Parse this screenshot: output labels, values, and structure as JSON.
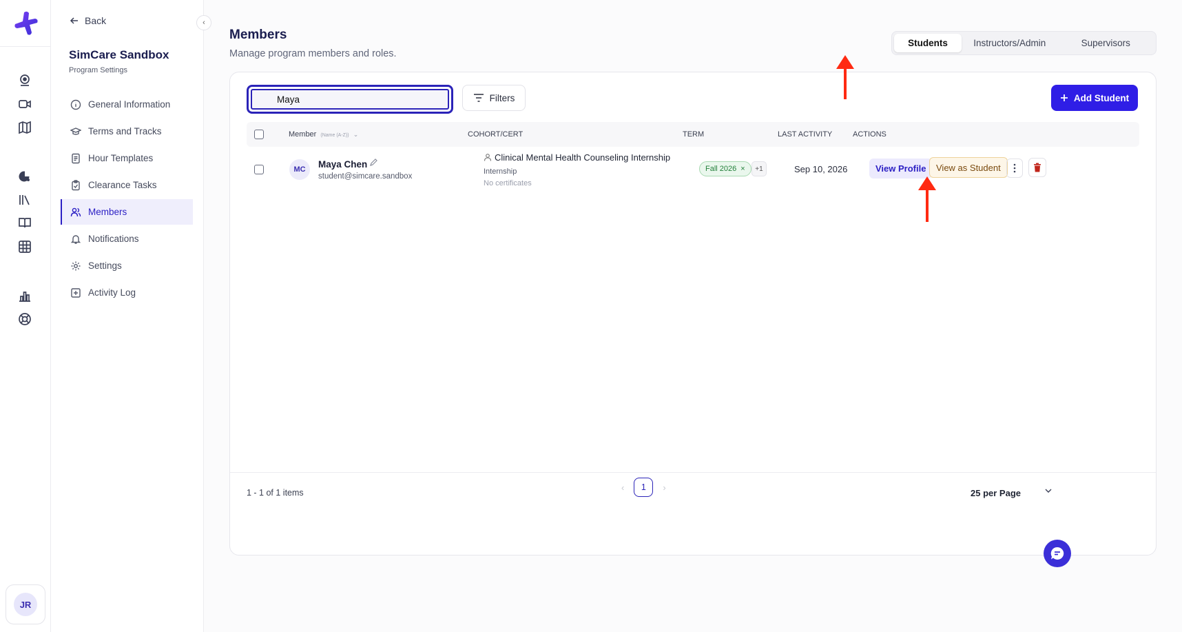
{
  "rail": {
    "avatar_initials": "JR",
    "icons": [
      "webcam-icon",
      "video-camera-icon",
      "map-icon",
      "chart-pie-icon",
      "library-icon",
      "open-book-icon",
      "grid-icon",
      "bar-chart-icon",
      "lifebuoy-icon"
    ]
  },
  "sidebar": {
    "back_label": "Back",
    "org_name": "SimCare Sandbox",
    "org_subtitle": "Program Settings",
    "items": [
      {
        "label": "General Information",
        "icon": "info-circle-icon"
      },
      {
        "label": "Terms and Tracks",
        "icon": "graduation-cap-icon"
      },
      {
        "label": "Hour Templates",
        "icon": "document-icon"
      },
      {
        "label": "Clearance Tasks",
        "icon": "clipboard-check-icon"
      },
      {
        "label": "Members",
        "icon": "users-icon",
        "active": true
      },
      {
        "label": "Notifications",
        "icon": "bell-icon"
      },
      {
        "label": "Settings",
        "icon": "gear-icon"
      },
      {
        "label": "Activity Log",
        "icon": "plus-square-icon"
      }
    ]
  },
  "header": {
    "title": "Members",
    "subtitle": "Manage program members and roles."
  },
  "tabs": [
    {
      "label": "Students",
      "active": true
    },
    {
      "label": "Instructors/Admin"
    },
    {
      "label": "Supervisors"
    }
  ],
  "toolbar": {
    "search_value": "Maya",
    "filters_label": "Filters",
    "add_label": "Add Student"
  },
  "table": {
    "columns": {
      "member": "Member",
      "member_sort": "(Name (A-Z))",
      "cohort": "COHORT/CERT",
      "term": "TERM",
      "last_activity": "LAST ACTIVITY",
      "actions": "ACTIONS"
    },
    "rows": [
      {
        "initials": "MC",
        "name": "Maya Chen",
        "email": "student@simcare.sandbox",
        "cohort": "Clinical Mental Health Counseling Internship",
        "cohort_type": "Internship",
        "certificates": "No certificates",
        "term": "Fall 2026",
        "term_more": "+1",
        "last_activity": "Sep 10, 2026",
        "view_profile": "View Profile",
        "view_as_student": "View as Student"
      }
    ]
  },
  "footer": {
    "count": "1 - 1 of 1 items",
    "page": "1",
    "per_page": "25 per Page"
  },
  "colors": {
    "accent": "#2f1ee6",
    "annotation": "#ff2a12"
  }
}
